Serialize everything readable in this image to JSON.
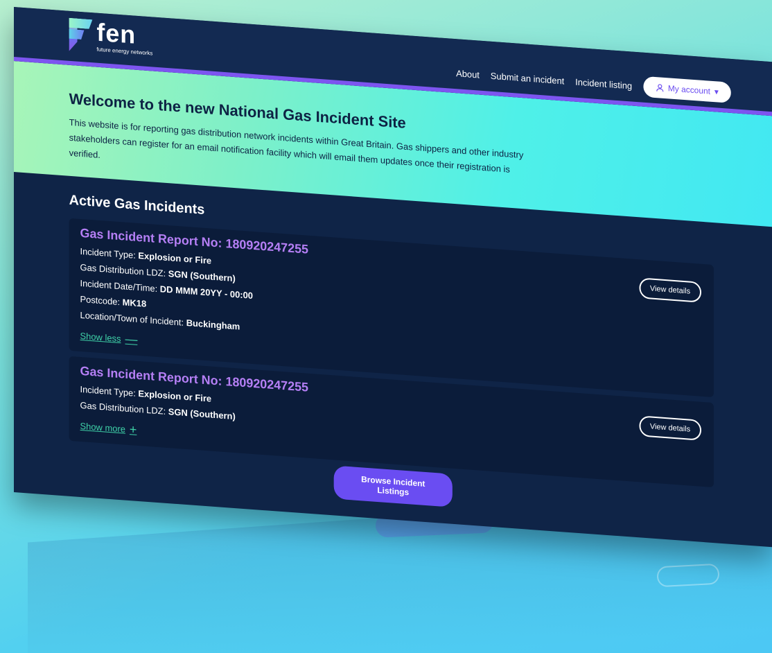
{
  "logo": {
    "name": "fen",
    "tagline": "future energy networks"
  },
  "nav": {
    "items": [
      "About",
      "Submit an incident",
      "Incident listing"
    ],
    "account_label": "My account"
  },
  "hero": {
    "title": "Welcome to the new National Gas Incident Site",
    "text": "This website is for reporting gas distribution network incidents within Great Britain. Gas shippers and other industry stakeholders can register for an email notification facility which will email them updates once their registration is verified."
  },
  "incidents": {
    "heading": "Active Gas Incidents",
    "cards": [
      {
        "title": "Gas Incident Report No: 180920247255",
        "type_label": "Incident Type: ",
        "type_value": "Explosion or Fire",
        "ldz_label": "Gas Distribution LDZ: ",
        "ldz_value": "SGN (Southern)",
        "date_label": "Incident Date/Time: ",
        "date_value": "DD MMM 20YY - 00:00",
        "postcode_label": "Postcode: ",
        "postcode_value": "MK18",
        "location_label": "Location/Town of Incident: ",
        "location_value": "Buckingham",
        "toggle": "Show less",
        "view": "View details"
      },
      {
        "title": "Gas Incident Report No: 180920247255",
        "type_label": "Incident Type: ",
        "type_value": "Explosion or Fire",
        "ldz_label": "Gas Distribution LDZ: ",
        "ldz_value": "SGN (Southern)",
        "toggle": "Show more",
        "view": "View details"
      }
    ],
    "browse_label": "Browse Incident Listings"
  },
  "colors": {
    "accent": "#6a4df2",
    "title": "#b57ff5",
    "link": "#3fd2a8",
    "navy": "#0f2447"
  }
}
